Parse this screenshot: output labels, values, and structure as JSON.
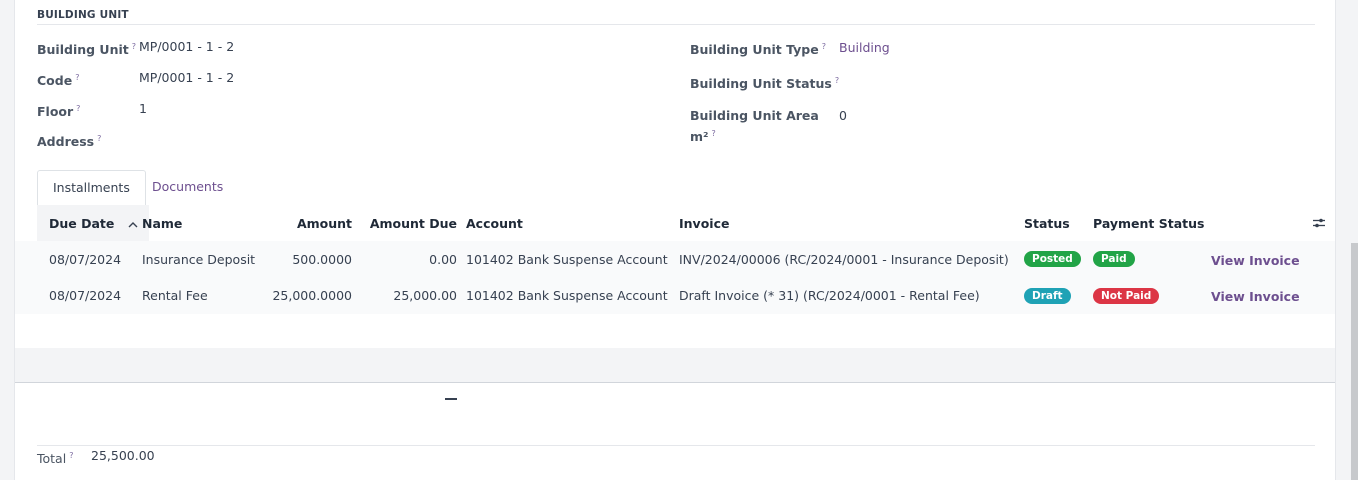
{
  "section": {
    "title": "BUILDING UNIT"
  },
  "fields_left": [
    {
      "label": "Building Unit",
      "help": "?",
      "value": "MP/0001 - 1 - 2"
    },
    {
      "label": "Code",
      "help": "?",
      "value": "MP/0001 - 1 - 2"
    },
    {
      "label": "Floor",
      "help": "?",
      "value": "1"
    },
    {
      "label": "Address",
      "help": "?",
      "value": ""
    }
  ],
  "fields_right": [
    {
      "label": "Building Unit Type",
      "help": "?",
      "value": "Building"
    },
    {
      "label": "Building Unit Status",
      "help": "?",
      "value": ""
    },
    {
      "label_line1": "Building Unit Area",
      "label_line2": "m²",
      "help": "?",
      "value": "0"
    }
  ],
  "tabs": [
    {
      "label": "Installments",
      "active": true
    },
    {
      "label": "Documents",
      "active": false
    }
  ],
  "table": {
    "columns": [
      "Due Date",
      "Name",
      "Amount",
      "Amount Due",
      "Account",
      "Invoice",
      "Status",
      "Payment Status"
    ],
    "sort_icon": "chevron-up-icon",
    "settings_icon": "sliders-icon",
    "rows": [
      {
        "due_date": "08/07/2024",
        "name": "Insurance Deposit",
        "amount": "500.0000",
        "amount_due": "0.00",
        "account": "101402 Bank Suspense Account",
        "invoice": "INV/2024/00006 (RC/2024/0001 - Insurance Deposit)",
        "status": "Posted",
        "payment_status": "Paid",
        "action": "View Invoice"
      },
      {
        "due_date": "08/07/2024",
        "name": "Rental Fee",
        "amount": "25,000.0000",
        "amount_due": "25,000.00",
        "account": "101402 Bank Suspense Account",
        "invoice": "Draft Invoice (* 31) (RC/2024/0001 - Rental Fee)",
        "status": "Draft",
        "payment_status": "Not Paid",
        "action": "View Invoice"
      }
    ]
  },
  "totals": {
    "label": "Total",
    "help": "?",
    "value": "25,500.00"
  },
  "colors": {
    "posted": "#22a447",
    "draft": "#1fa2b5",
    "paid": "#22a447",
    "not_paid": "#dc3545",
    "link": "#6d4f8f"
  }
}
